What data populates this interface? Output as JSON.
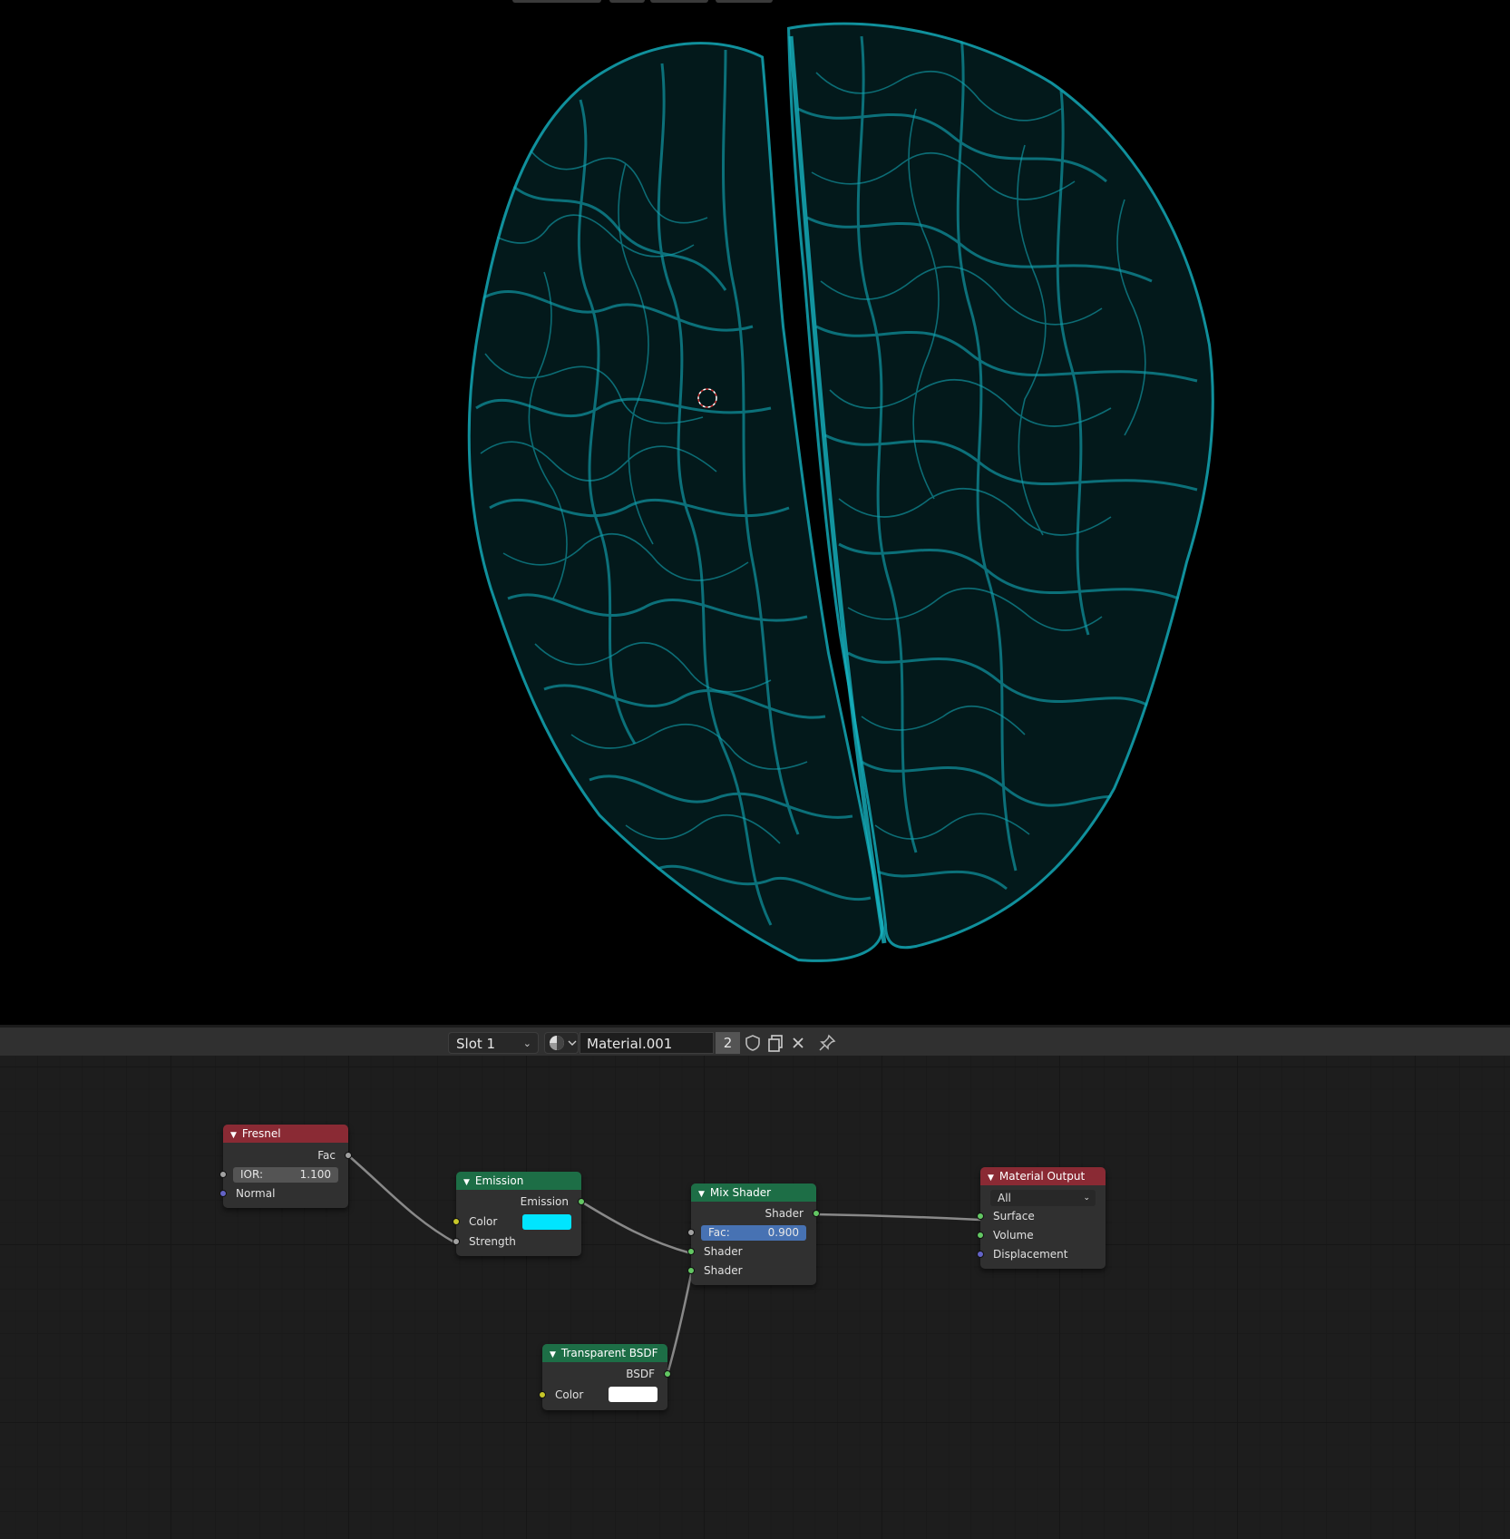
{
  "viewport": {
    "object": "brain vessel mesh",
    "accent_color": "#0f8e9a",
    "cursor_icon": "3d-cursor-icon"
  },
  "header": {
    "slot": "Slot 1",
    "material_type_icon": "material-sphere-icon",
    "material_name": "Material.001",
    "users": "2",
    "icons": [
      "shield-icon",
      "duplicate-icon",
      "close-icon",
      "pin-icon"
    ]
  },
  "nodes": {
    "fresnel": {
      "title": "Fresnel",
      "output_fac": "Fac",
      "ior_label": "IOR:",
      "ior_value": "1.100",
      "input_normal": "Normal"
    },
    "emission": {
      "title": "Emission",
      "output": "Emission",
      "input_color": "Color",
      "color_value": "#00e5ff",
      "input_strength": "Strength"
    },
    "mix_shader": {
      "title": "Mix Shader",
      "output": "Shader",
      "fac_label": "Fac:",
      "fac_value": "0.900",
      "input_shader_1": "Shader",
      "input_shader_2": "Shader"
    },
    "transparent_bsdf": {
      "title": "Transparent BSDF",
      "output": "BSDF",
      "input_color": "Color",
      "color_value": "#ffffff"
    },
    "material_output": {
      "title": "Material Output",
      "target": "All",
      "input_surface": "Surface",
      "input_volume": "Volume",
      "input_displacement": "Displacement"
    }
  },
  "colors": {
    "header_red": "#8a2a34",
    "header_green": "#1d6e46",
    "socket_shader": "#63c763",
    "socket_color": "#c7c729",
    "socket_float": "#a1a1a1",
    "socket_vector": "#6363c7",
    "field_active": "#4772b3"
  }
}
